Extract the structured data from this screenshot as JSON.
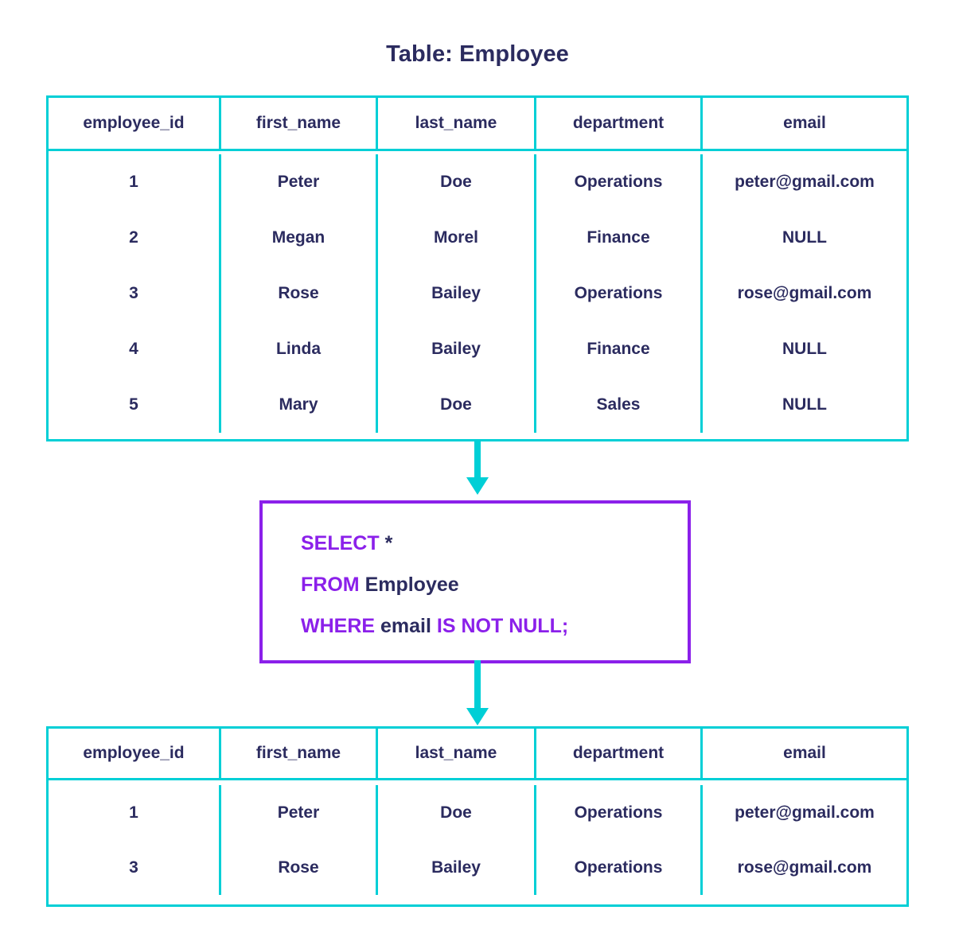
{
  "title": "Table: Employee",
  "colors": {
    "table_border": "#00CFD6",
    "text_navy": "#2B2B5F",
    "keyword_purple": "#8B20EA",
    "query_box_border": "#8B20EA",
    "arrow": "#00CFD6",
    "background": "#FFFFFF"
  },
  "source_table": {
    "name": "Employee",
    "columns": [
      "employee_id",
      "first_name",
      "last_name",
      "department",
      "email"
    ],
    "rows": [
      [
        "1",
        "Peter",
        "Doe",
        "Operations",
        "peter@gmail.com"
      ],
      [
        "2",
        "Megan",
        "Morel",
        "Finance",
        "NULL"
      ],
      [
        "3",
        "Rose",
        "Bailey",
        "Operations",
        "rose@gmail.com"
      ],
      [
        "4",
        "Linda",
        "Bailey",
        "Finance",
        "NULL"
      ],
      [
        "5",
        "Mary",
        "Doe",
        "Sales",
        "NULL"
      ]
    ]
  },
  "query": {
    "lines": [
      [
        {
          "text": "SELECT",
          "type": "keyword"
        },
        {
          "text": " ",
          "type": "space"
        },
        {
          "text": "*",
          "type": "identifier"
        }
      ],
      [
        {
          "text": "FROM",
          "type": "keyword"
        },
        {
          "text": " ",
          "type": "space"
        },
        {
          "text": "Employee",
          "type": "identifier"
        }
      ],
      [
        {
          "text": "WHERE",
          "type": "keyword"
        },
        {
          "text": " ",
          "type": "space"
        },
        {
          "text": "email",
          "type": "identifier"
        },
        {
          "text": " ",
          "type": "space"
        },
        {
          "text": "IS NOT NULL;",
          "type": "keyword"
        }
      ]
    ],
    "full_text": "SELECT * FROM Employee WHERE email IS NOT NULL;"
  },
  "result_table": {
    "columns": [
      "employee_id",
      "first_name",
      "last_name",
      "department",
      "email"
    ],
    "rows": [
      [
        "1",
        "Peter",
        "Doe",
        "Operations",
        "peter@gmail.com"
      ],
      [
        "3",
        "Rose",
        "Bailey",
        "Operations",
        "rose@gmail.com"
      ]
    ]
  },
  "arrows": [
    {
      "name": "arrow-table-to-query",
      "direction": "down"
    },
    {
      "name": "arrow-query-to-result",
      "direction": "down"
    }
  ]
}
